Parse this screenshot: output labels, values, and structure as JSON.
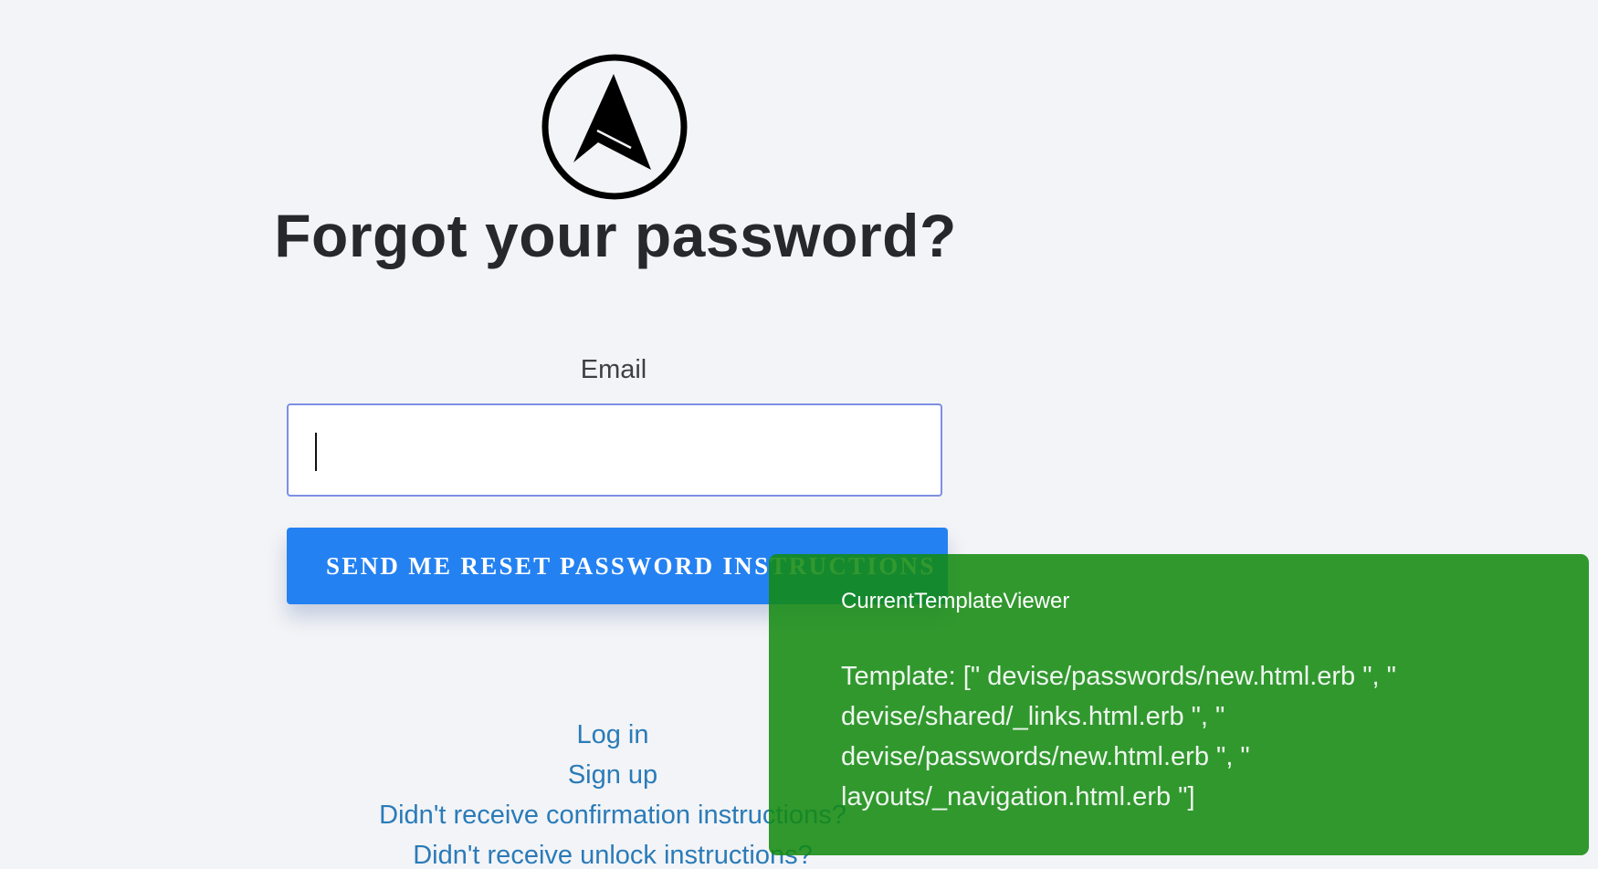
{
  "logo": {
    "icon": "navigation-arrow-icon",
    "colors": {
      "stroke": "#000000",
      "fill": "#000000"
    }
  },
  "header": {
    "title": "Forgot your password?"
  },
  "form": {
    "email_label": "Email",
    "email_value": "",
    "submit_label": "SEND ME RESET PASSWORD INSTRUCTIONS"
  },
  "links": [
    {
      "label": "Log in"
    },
    {
      "label": "Sign up"
    },
    {
      "label": "Didn't receive confirmation instructions?"
    },
    {
      "label": "Didn't receive unlock instructions?"
    }
  ],
  "overlay": {
    "title": "CurrentTemplateViewer",
    "body": "Template: [\" devise/passwords/new.html.erb \", \" devise/shared/_links.html.erb \", \" devise/passwords/new.html.erb \", \" layouts/_navigation.html.erb \"]"
  },
  "colors": {
    "background": "#f3f4f7",
    "primary_button": "#2481f1",
    "link": "#2a7bb8",
    "input_border": "#7d8fe4",
    "overlay": "#148a10"
  }
}
